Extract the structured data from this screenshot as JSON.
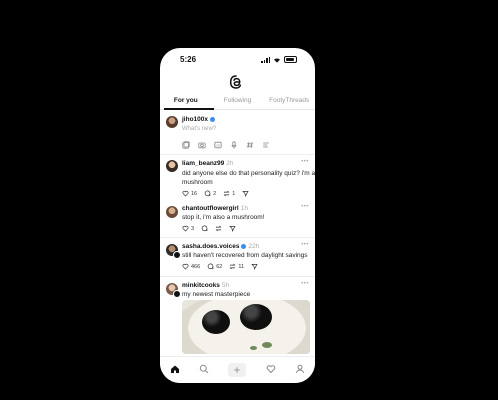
{
  "status": {
    "time": "5:26"
  },
  "tabs": [
    {
      "label": "For you",
      "active": true
    },
    {
      "label": "Following",
      "active": false
    },
    {
      "label": "FootyThreads",
      "active": false
    }
  ],
  "compose": {
    "username": "jiho100x",
    "placeholder": "What's new?"
  },
  "posts": [
    {
      "username": "liam_beanz99",
      "time": "2h",
      "lines": [
        "did anyone else do that personality quiz? i'm a",
        "mushroom"
      ],
      "likes": "16",
      "comments": "2",
      "reposts": "1",
      "shares": ""
    },
    {
      "username": "chantoutflowergirl",
      "time": "1h",
      "lines": [
        "stop it, i'm also a mushroom!"
      ],
      "likes": "3",
      "comments": "",
      "reposts": "",
      "shares": ""
    },
    {
      "username": "sasha.does.voices",
      "time": "22h",
      "lines": [
        "still haven't recovered from daylight savings"
      ],
      "likes": "466",
      "comments": "62",
      "reposts": "11",
      "shares": ""
    },
    {
      "username": "minkitcooks",
      "time": "5h",
      "lines": [
        "my newest masterpiece"
      ],
      "likes": "",
      "comments": "",
      "reposts": "",
      "shares": ""
    }
  ],
  "icons": {
    "logo": "threads-logo-icon",
    "nav": [
      "home-icon",
      "search-icon",
      "plus-icon",
      "heart-icon",
      "profile-icon"
    ]
  }
}
